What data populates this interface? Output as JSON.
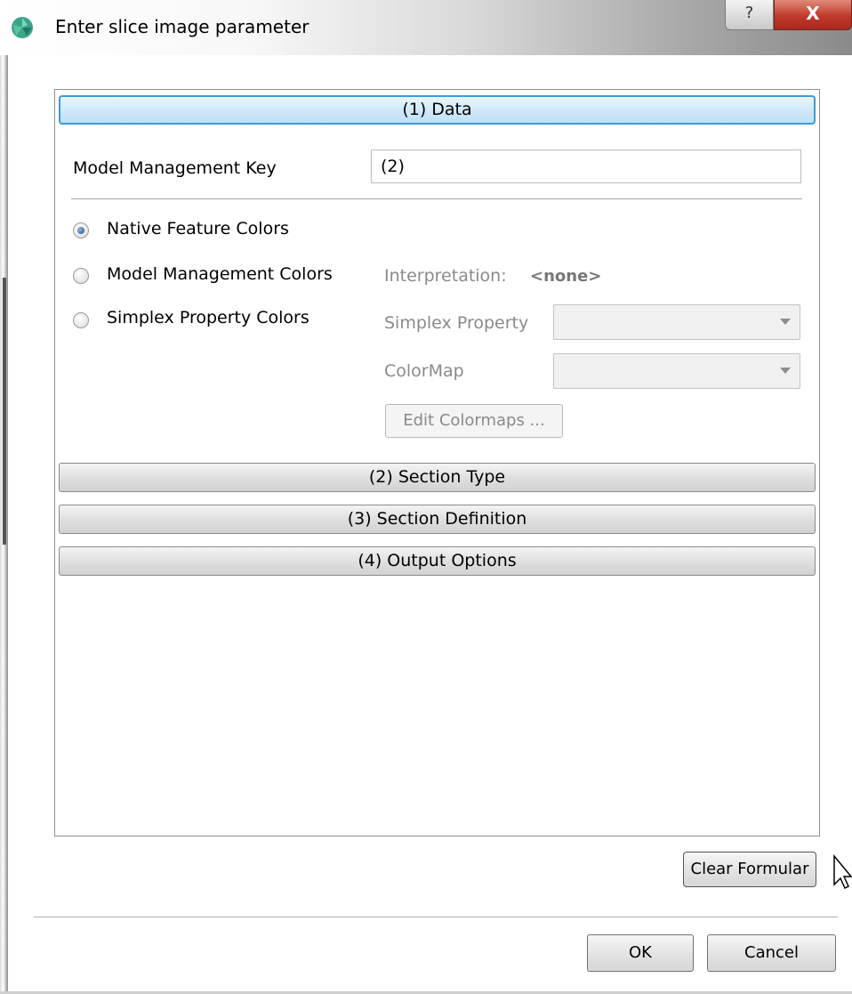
{
  "window": {
    "title": "Enter slice image parameter",
    "help_glyph": "?",
    "close_glyph": "X"
  },
  "sections": {
    "data": "(1) Data",
    "section_type": "(2) Section Type",
    "section_definition": "(3) Section Definition",
    "output_options": "(4) Output Options"
  },
  "form": {
    "key_label": "Model Management Key",
    "key_value": "(2)",
    "color_modes": [
      {
        "label": "Native Feature Colors",
        "checked": true
      },
      {
        "label": "Model Management Colors",
        "checked": false
      },
      {
        "label": "Simplex Property Colors",
        "checked": false
      }
    ],
    "interpretation_label": "Interpretation:",
    "interpretation_value": "<none>",
    "simplex_property_label": "Simplex Property",
    "colormap_label": "ColorMap",
    "edit_colormaps": "Edit Colormaps ..."
  },
  "buttons": {
    "clear": "Clear Formular",
    "ok": "OK",
    "cancel": "Cancel"
  }
}
